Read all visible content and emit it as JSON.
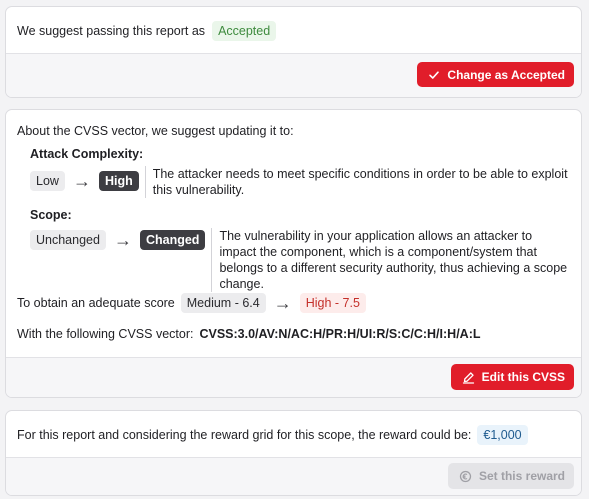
{
  "status_card": {
    "text": "We suggest passing this report as",
    "status": "Accepted",
    "button": "Change as Accepted"
  },
  "cvss_card": {
    "intro": "About the CVSS vector, we suggest updating it to:",
    "metrics": [
      {
        "label": "Attack Complexity:",
        "from": "Low",
        "to": "High",
        "description": "The attacker needs to meet specific conditions in order to be able to exploit this vulnerability."
      },
      {
        "label": "Scope:",
        "from": "Unchanged",
        "to": "Changed",
        "description": "The vulnerability in your application allows an attacker to impact the component, which is a component/system that belongs to a different security authority, thus achieving a scope change."
      }
    ],
    "score_text": "To obtain an adequate score",
    "score_from": "Medium - 6.4",
    "score_to": "High - 7.5",
    "vector_text": "With the following CVSS vector:",
    "vector": "CVSS:3.0/AV:N/AC:H/PR:H/UI:R/S:C/C:H/I:H/A:L",
    "button": "Edit this CVSS"
  },
  "reward_card": {
    "text": "For this report and considering the reward grid for this scope, the reward could be:",
    "amount": "€1,000",
    "button": "Set this reward"
  },
  "colors": {
    "primary_red": "#e11d2a",
    "accepted_green": "#3e8b3e",
    "severity_high": "#c4302a",
    "reward_blue": "#1f5b8f"
  },
  "icons": {
    "accept_button": "check-icon",
    "edit_button": "pencil-icon",
    "reward_button": "coin-icon",
    "transition": "arrow-right-icon"
  }
}
